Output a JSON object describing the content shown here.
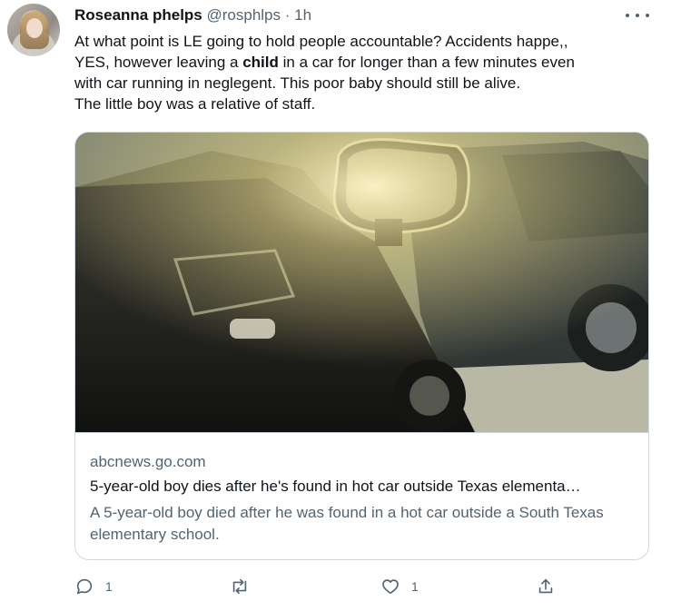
{
  "tweet": {
    "author_name": "Roseanna phelps",
    "handle": "@rosphlps",
    "separator": "·",
    "time": "1h",
    "text": {
      "line1": "At what point is LE going to hold people accountable? Accidents happe,,",
      "line2_a": "YES, however leaving a ",
      "line2_bold": "child",
      "line2_b": " in a car for longer than a few minutes even",
      "line3": "with car running in neglegent. This poor baby should still be alive.",
      "line4": "The little boy was a relative of staff."
    }
  },
  "card": {
    "domain": "abcnews.go.com",
    "title": "5-year-old boy dies after he's found in hot car outside Texas elementa…",
    "description": "A 5-year-old boy died after he was found in a hot car outside a South Texas elementary school."
  },
  "actions": {
    "reply_count": "1",
    "like_count": "1"
  },
  "icons": {
    "more": "more-icon",
    "reply": "reply-icon",
    "retweet": "retweet-icon",
    "like": "like-icon",
    "share": "share-icon"
  },
  "colors": {
    "text": "#0f1419",
    "muted": "#536471",
    "border": "#cfd9de"
  }
}
